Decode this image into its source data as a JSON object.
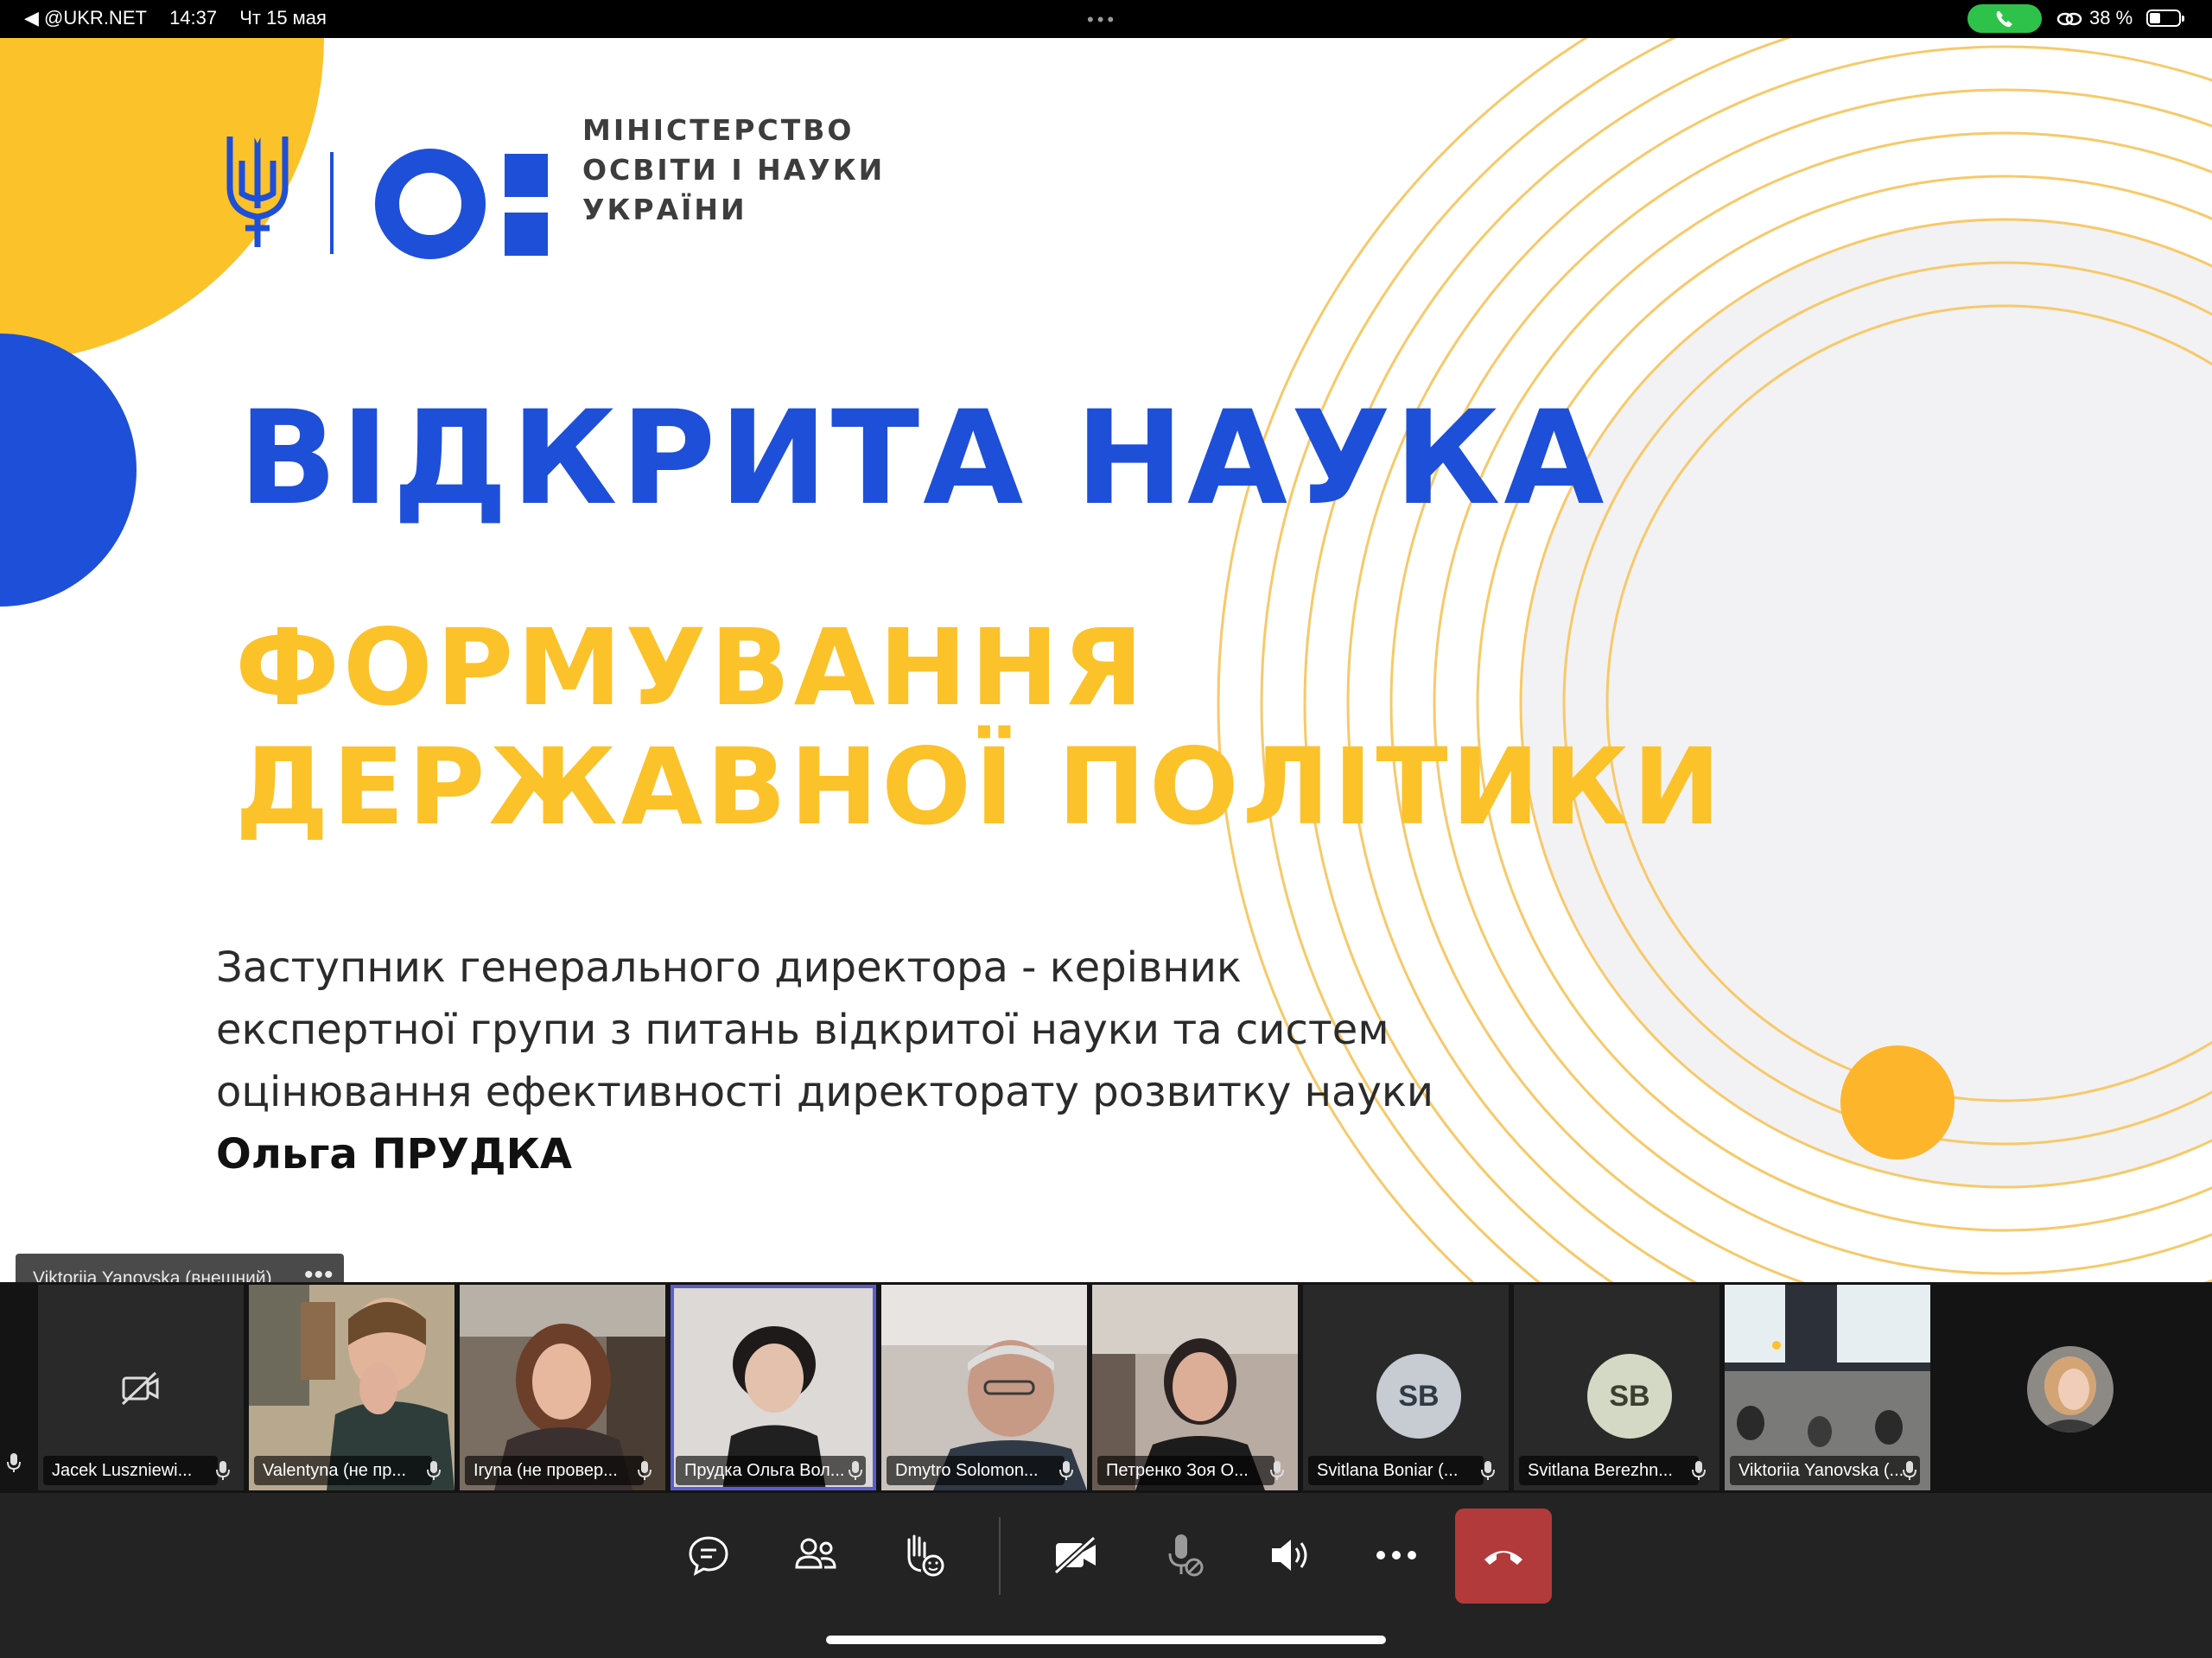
{
  "status_bar": {
    "back_label": "◀ @UKR.NET",
    "time": "14:37",
    "date": "Чт 15 мая",
    "battery_text": "38 %",
    "battery_level": 0.38,
    "call_color": "#2fc24a"
  },
  "slide": {
    "ministry_lines": [
      "МІНІСТЕРСТВО",
      "ОСВІТИ І НАУКИ",
      "УКРАЇНИ"
    ],
    "title": "ВІДКРИТА НАУКА",
    "subtitle_lines": [
      "ФОРМУВАННЯ",
      "ДЕРЖАВНОЇ ПОЛІТИКИ"
    ],
    "description_lines": [
      "Заступник генерального директора - керівник",
      "експертної групи з питань відкритої науки та систем",
      "оцінювання ефективності директорату розвитку науки"
    ],
    "speaker_name": "Ольга ПРУДКА",
    "colors": {
      "blue": "#1e4fd8",
      "yellow": "#fcc22a"
    }
  },
  "presenter_tag": {
    "label": "Viktoriia Yanovska (внешний)",
    "more": "•••"
  },
  "participants": [
    {
      "name": "Jacek Luszniewi...",
      "video": false,
      "icon": "camera-off-icon"
    },
    {
      "name": "Valentyna (не пр...",
      "video": true
    },
    {
      "name": "Iryna (не провер...",
      "video": true
    },
    {
      "name": "Прудка Ольга Вол...",
      "video": true,
      "speaking": true
    },
    {
      "name": "Dmytro Solomon...",
      "video": true
    },
    {
      "name": "Петренко Зоя О...",
      "video": true
    },
    {
      "name": "Svitlana Boniar (...",
      "video": false,
      "initials": "SB"
    },
    {
      "name": "Svitlana Berezhn...",
      "video": false,
      "initials": "SB"
    },
    {
      "name": "Viktoriia Yanovska (...",
      "video": true
    }
  ],
  "controls": [
    {
      "name": "chat-button",
      "icon": "chat-icon"
    },
    {
      "name": "people-button",
      "icon": "people-icon"
    },
    {
      "name": "react-button",
      "icon": "raise-hand-icon"
    },
    {
      "name": "camera-toggle-button",
      "icon": "camera-off-icon"
    },
    {
      "name": "mic-toggle-button",
      "icon": "mic-off-icon"
    },
    {
      "name": "speaker-button",
      "icon": "speaker-icon"
    },
    {
      "name": "more-button",
      "icon": "more-icon"
    },
    {
      "name": "hang-up-button",
      "icon": "phone-hangup-icon",
      "color": "#b33a3a"
    }
  ]
}
